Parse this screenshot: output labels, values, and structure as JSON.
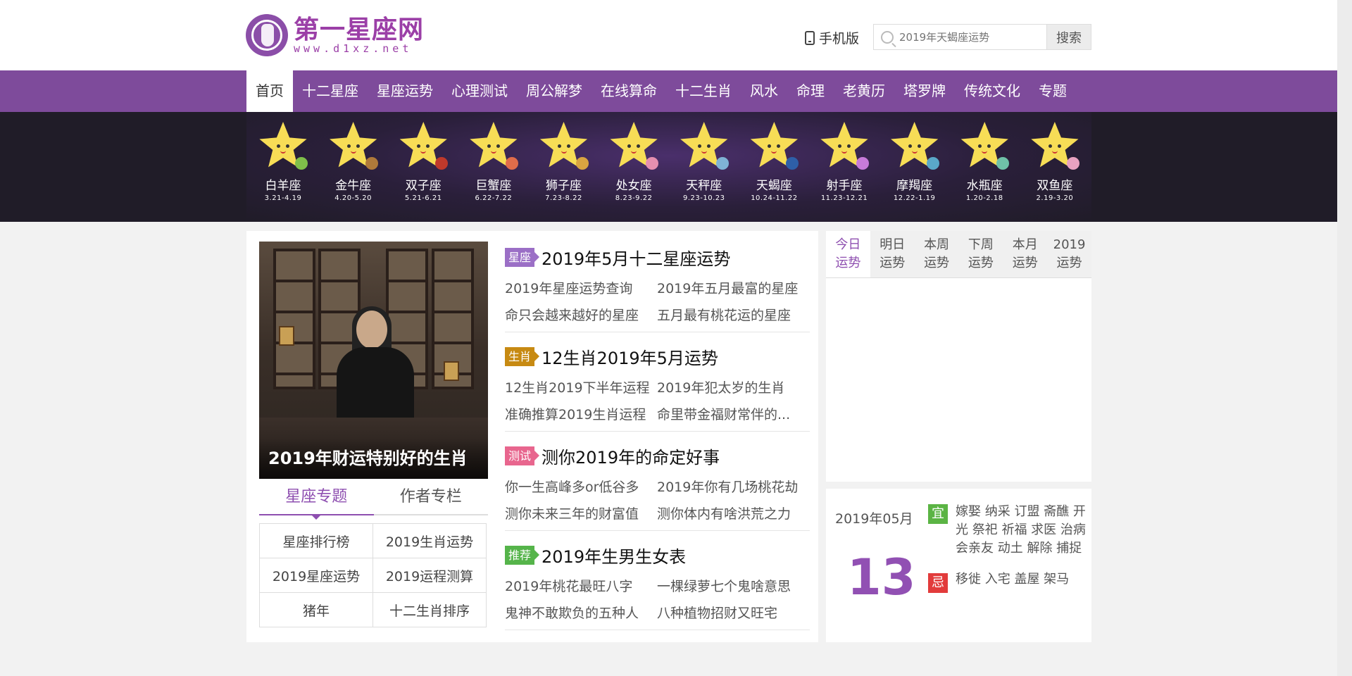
{
  "header": {
    "logo_title": "第一星座网",
    "logo_url": "www.d1xz.net",
    "mobile_label": "手机版",
    "search_placeholder": "2019年天蝎座运势",
    "search_button": "搜索"
  },
  "nav": [
    {
      "label": "首页",
      "active": true
    },
    {
      "label": "十二星座"
    },
    {
      "label": "星座运势"
    },
    {
      "label": "心理测试"
    },
    {
      "label": "周公解梦"
    },
    {
      "label": "在线算命"
    },
    {
      "label": "十二生肖"
    },
    {
      "label": "风水"
    },
    {
      "label": "命理"
    },
    {
      "label": "老黄历"
    },
    {
      "label": "塔罗牌"
    },
    {
      "label": "传统文化"
    },
    {
      "label": "专题"
    }
  ],
  "zodiac": [
    {
      "name": "白羊座",
      "date": "3.21-4.19",
      "accent": "#7fbf4a"
    },
    {
      "name": "金牛座",
      "date": "4.20-5.20",
      "accent": "#b07a3a"
    },
    {
      "name": "双子座",
      "date": "5.21-6.21",
      "accent": "#c0392b"
    },
    {
      "name": "巨蟹座",
      "date": "6.22-7.22",
      "accent": "#e06c4a"
    },
    {
      "name": "狮子座",
      "date": "7.23-8.22",
      "accent": "#d9a441"
    },
    {
      "name": "处女座",
      "date": "8.23-9.22",
      "accent": "#e58fb0"
    },
    {
      "name": "天秤座",
      "date": "9.23-10.23",
      "accent": "#7fb3d5"
    },
    {
      "name": "天蝎座",
      "date": "10.24-11.22",
      "accent": "#2e5fa8"
    },
    {
      "name": "射手座",
      "date": "11.23-12.21",
      "accent": "#c77bd9"
    },
    {
      "name": "摩羯座",
      "date": "12.22-1.19",
      "accent": "#5aa8c9"
    },
    {
      "name": "水瓶座",
      "date": "1.20-2.18",
      "accent": "#6fc1a8"
    },
    {
      "name": "双鱼座",
      "date": "2.19-3.20",
      "accent": "#e8a2c0"
    }
  ],
  "feature": {
    "caption": "2019年财运特别好的生肖"
  },
  "left_tabs": [
    {
      "label": "星座专题",
      "active": true
    },
    {
      "label": "作者专栏"
    }
  ],
  "topics": [
    [
      "星座排行榜",
      "2019生肖运势"
    ],
    [
      "2019星座运势",
      "2019运程测算"
    ],
    [
      "猪年",
      "十二生肖排序"
    ]
  ],
  "articles": [
    {
      "tag": "星座",
      "tag_color": "#9b6fc6",
      "title": "2019年5月十二星座运势",
      "links": [
        "2019年星座运势查询",
        "2019年五月最富的星座",
        "命只会越来越好的星座",
        "五月最有桃花运的星座"
      ]
    },
    {
      "tag": "生肖",
      "tag_color": "#c78a12",
      "title": "12生肖2019年5月运势",
      "links": [
        "12生肖2019下半年运程",
        "2019年犯太岁的生肖",
        "准确推算2019生肖运程",
        "命里带金福财常伴的..."
      ]
    },
    {
      "tag": "测试",
      "tag_color": "#e8668e",
      "title": "测你2019年的命定好事",
      "links": [
        "你一生高峰多or低谷多",
        "2019年你有几场桃花劫",
        "测你未来三年的财富值",
        "测你体内有啥洪荒之力"
      ]
    },
    {
      "tag": "推荐",
      "tag_color": "#55b44a",
      "title": "2019年生男生女表",
      "links": [
        "2019年桃花最旺八字",
        "一棵绿萝七个鬼啥意思",
        "鬼神不敢欺负的五种人",
        "八种植物招财又旺宅"
      ]
    }
  ],
  "fortune_tabs": [
    {
      "line1": "今日",
      "line2": "运势",
      "active": true
    },
    {
      "line1": "明日",
      "line2": "运势"
    },
    {
      "line1": "本周",
      "line2": "运势"
    },
    {
      "line1": "下周",
      "line2": "运势"
    },
    {
      "line1": "本月",
      "line2": "运势"
    },
    {
      "line1": "2019",
      "line2": "运势"
    }
  ],
  "calendar": {
    "month": "2019年05月",
    "day": "13",
    "yi_label": "宜",
    "yi": "嫁娶 纳采 订盟 斋醮 开光 祭祀 祈福 求医 治病 会亲友 动土 解除 捕捉",
    "ji_label": "忌",
    "ji": "移徙 入宅 盖屋 架马"
  }
}
